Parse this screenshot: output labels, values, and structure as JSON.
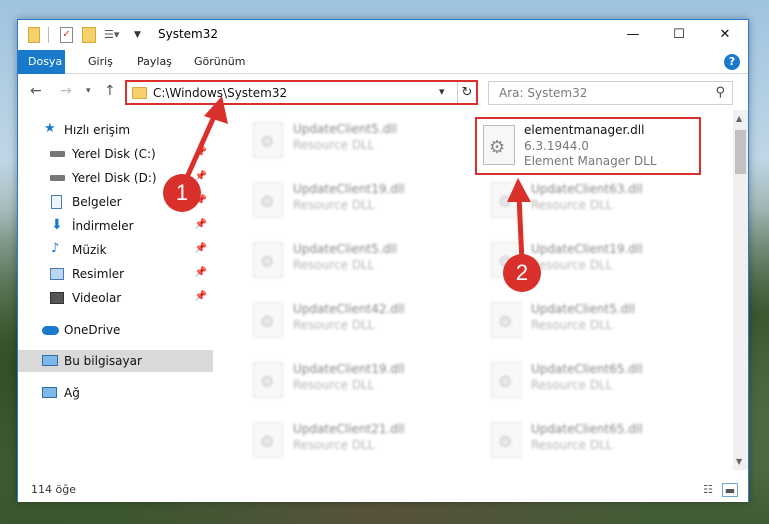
{
  "window": {
    "title": "System32",
    "controls": {
      "minimize": "—",
      "maximize": "☐",
      "close": "✕"
    }
  },
  "ribbon": {
    "tabs": [
      "Dosya",
      "Giriş",
      "Paylaş",
      "Görünüm"
    ],
    "help_label": "?"
  },
  "address": {
    "path": "C:\\Windows\\System32",
    "search_placeholder": "Ara: System32"
  },
  "sidebar": {
    "items": [
      {
        "label": "Hızlı erişim",
        "icon": "star-icon",
        "pinned": false
      },
      {
        "label": "Yerel Disk (C:)",
        "icon": "drive-icon",
        "pinned": true
      },
      {
        "label": "Yerel Disk (D:)",
        "icon": "drive-icon",
        "pinned": true
      },
      {
        "label": "Belgeler",
        "icon": "documents-icon",
        "pinned": true
      },
      {
        "label": "İndirmeler",
        "icon": "downloads-icon",
        "pinned": true
      },
      {
        "label": "Müzik",
        "icon": "music-icon",
        "pinned": true
      },
      {
        "label": "Resimler",
        "icon": "pictures-icon",
        "pinned": true
      },
      {
        "label": "Videolar",
        "icon": "videos-icon",
        "pinned": true
      },
      {
        "label": "OneDrive",
        "icon": "cloud-icon",
        "pinned": false
      },
      {
        "label": "Bu bilgisayar",
        "icon": "computer-icon",
        "pinned": false,
        "selected": true
      },
      {
        "label": "Ağ",
        "icon": "network-icon",
        "pinned": false
      }
    ]
  },
  "files": {
    "highlighted": {
      "name": "elementmanager.dll",
      "version": "6.3.1944.0",
      "description": "Element Manager DLL"
    },
    "left_column": [
      {
        "name": "UpdateClient5.dll",
        "description": "Resource DLL"
      },
      {
        "name": "UpdateClient19.dll",
        "description": "Resource DLL"
      },
      {
        "name": "UpdateClient5.dll",
        "description": "Resource DLL"
      },
      {
        "name": "UpdateClient42.dll",
        "description": "Resource DLL"
      },
      {
        "name": "UpdateClient19.dll",
        "description": "Resource DLL"
      },
      {
        "name": "UpdateClient21.dll",
        "description": "Resource DLL"
      }
    ],
    "right_column": [
      {
        "name": "UpdateClient63.dll",
        "description": "Resource DLL"
      },
      {
        "name": "UpdateClient19.dll",
        "description": "Resource DLL"
      },
      {
        "name": "UpdateClient5.dll",
        "description": "Resource DLL"
      },
      {
        "name": "UpdateClient65.dll",
        "description": "Resource DLL"
      },
      {
        "name": "UpdateClient65.dll",
        "description": "Resource DLL"
      }
    ]
  },
  "status": {
    "count": "114 öğe"
  },
  "annotations": {
    "badge1": "1",
    "badge2": "2"
  },
  "colors": {
    "accent": "#1979ca",
    "highlight": "#d9302c"
  }
}
